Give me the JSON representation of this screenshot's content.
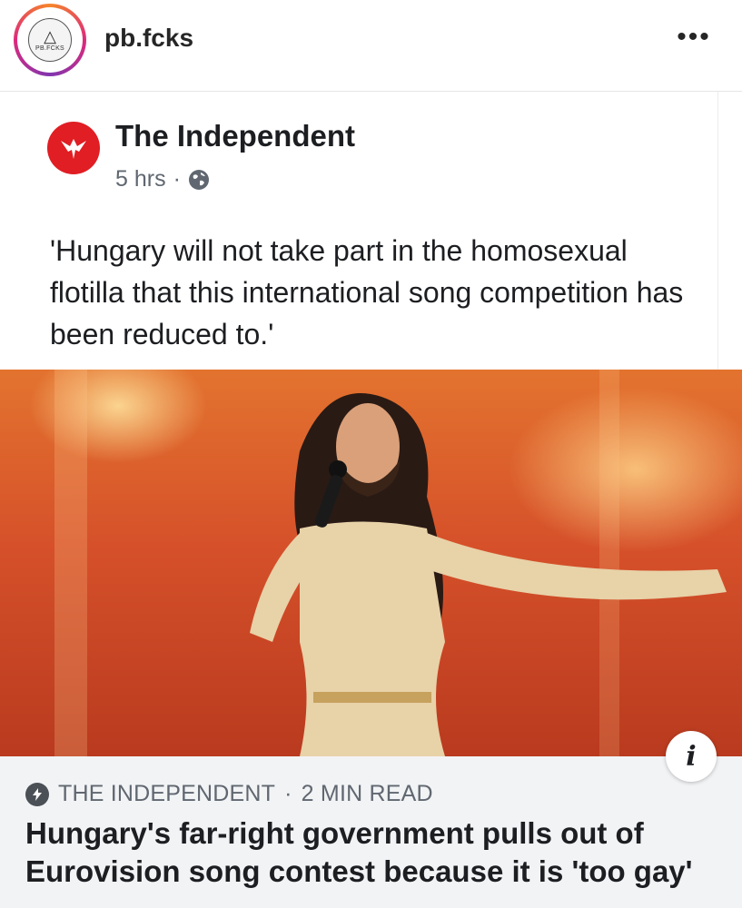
{
  "header": {
    "username": "pb.fcks",
    "avatar_text": "PB.FCKS",
    "more_label": "•••"
  },
  "post": {
    "publisher": "The Independent",
    "time": "5 hrs",
    "separator": "·",
    "text": "'Hungary will not take part in the homosexual flotilla that this international song competition has been reduced to.'"
  },
  "link": {
    "source": "THE INDEPENDENT",
    "read_time": "2 MIN READ",
    "separator": "·",
    "title": "Hungary's far-right government pulls out of Eurovision song contest because it is 'too gay'",
    "info_label": "i"
  },
  "colors": {
    "publisher_red": "#e01e24",
    "link_bg": "#f2f3f5",
    "ig_ring": "#dd2a7b"
  },
  "icons": {
    "globe": "globe-icon",
    "bolt": "lightning-bolt-icon",
    "more": "more-options-icon",
    "info": "info-icon"
  }
}
